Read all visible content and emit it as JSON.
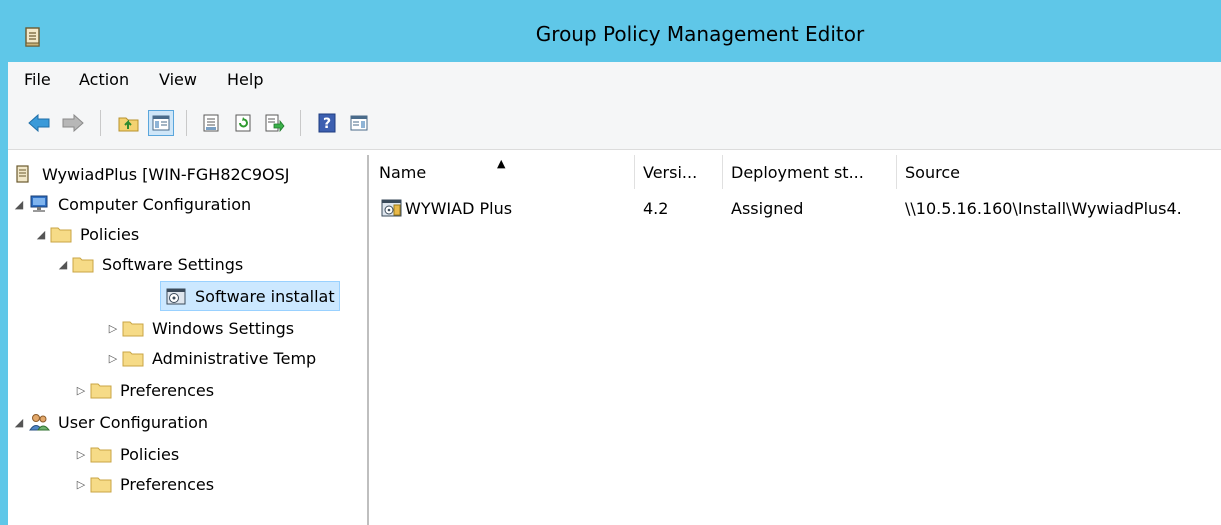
{
  "window": {
    "title": "Group Policy Management Editor",
    "accent": "#5fc7e8"
  },
  "menu": {
    "items": [
      "File",
      "Action",
      "View",
      "Help"
    ]
  },
  "toolbar": {
    "buttons": [
      "back-arrow-icon",
      "forward-arrow-icon",
      "up-folder-icon",
      "show-hide-tree-icon",
      "properties-icon",
      "refresh-icon",
      "export-list-icon",
      "help-icon",
      "show-hide-action-pane-icon"
    ]
  },
  "tree": {
    "root": "WywiadPlus [WIN-FGH82C9OSJ",
    "computer_configuration": "Computer Configuration",
    "cc_policies": "Policies",
    "software_settings": "Software Settings",
    "software_installation": "Software installat",
    "windows_settings": "Windows Settings",
    "administrative_templates": "Administrative Temp",
    "cc_preferences": "Preferences",
    "user_configuration": "User Configuration",
    "uc_policies": "Policies",
    "uc_preferences": "Preferences"
  },
  "list": {
    "columns": {
      "name": "Name",
      "version": "Versi...",
      "deployment": "Deployment st...",
      "source": "Source"
    },
    "sort_indicator": "▲",
    "rows": [
      {
        "name": "WYWIAD Plus",
        "version": "4.2",
        "deployment": "Assigned",
        "source": "\\\\10.5.16.160\\Install\\WywiadPlus4."
      }
    ]
  }
}
